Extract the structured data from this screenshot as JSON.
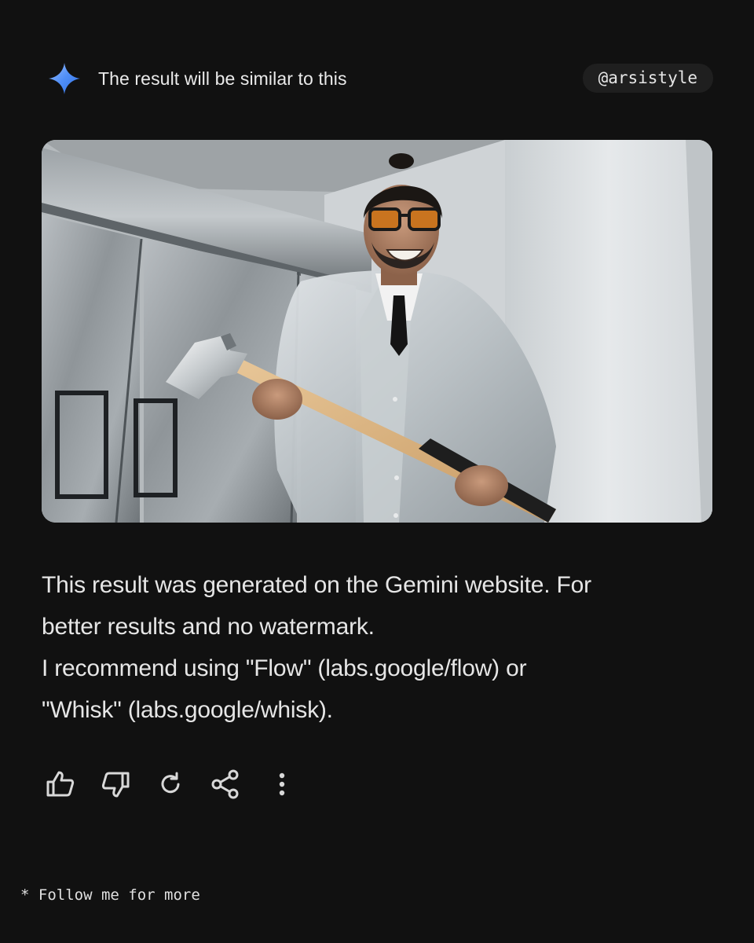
{
  "header": {
    "icon": "gemini-sparkle-icon",
    "title": "The result will be similar to this",
    "handle": "@arsistyle"
  },
  "image": {
    "description_icon": "generated-image",
    "accent_color": "#4f8ef7"
  },
  "message": {
    "lines": [
      "This result was generated on the Gemini website. For",
      "better results and no watermark.",
      "I recommend using \"Flow\" (labs.google/flow) or",
      "\"Whisk\" (labs.google/whisk)."
    ]
  },
  "actions": [
    {
      "icon": "thumbs-up-icon"
    },
    {
      "icon": "thumbs-down-icon"
    },
    {
      "icon": "regenerate-icon"
    },
    {
      "icon": "share-icon"
    },
    {
      "icon": "more-vert-icon"
    }
  ],
  "footer": {
    "text": "* Follow me for more"
  }
}
